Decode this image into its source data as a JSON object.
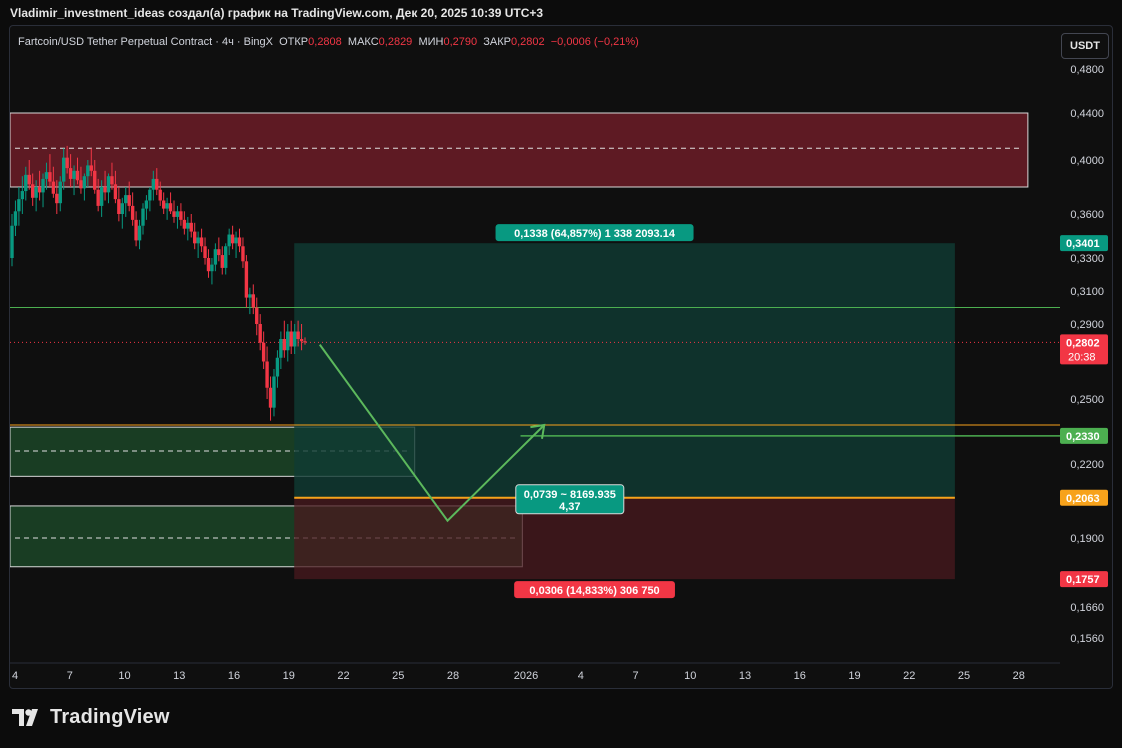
{
  "header": {
    "attribution": "Vladimir_investment_ideas создал(а) график на TradingView.com, Дек 20, 2025 10:39 UTC+3"
  },
  "legend": {
    "symbol": "Fartcoin/USD Tether Perpetual Contract · 4ч · BingX",
    "open_label": "ОТКР",
    "open": "0,2808",
    "high_label": "МАКС",
    "high": "0,2829",
    "low_label": "МИН",
    "low": "0,2790",
    "close_label": "ЗАКР",
    "close": "0,2802",
    "change": "−0,0006 (−0,21%)"
  },
  "currency_button": "USDT",
  "footer": {
    "brand": "TradingView"
  },
  "colors": {
    "up": "#089981",
    "down": "#f23645",
    "green_line": "#4caf50",
    "orange_line": "#f7a21b",
    "supply_zone": "#7a1f2b",
    "demand_zone": "#1e4d2b",
    "target_zone": "#0f3b33",
    "stop_zone": "#4a1a1f",
    "badge_teal": "#089981",
    "badge_red": "#f23645"
  },
  "chart_data": {
    "type": "candlestick",
    "yaxis_ticks": [
      "0,4800",
      "0,4400",
      "0,4000",
      "0,3600",
      "0,3300",
      "0,3100",
      "0,2900",
      "0,2500",
      "0,2200",
      "0,1900",
      "0,1660",
      "0,1560"
    ],
    "ytick_values": [
      0.48,
      0.44,
      0.4,
      0.36,
      0.33,
      0.31,
      0.29,
      0.25,
      0.22,
      0.19,
      0.166,
      0.156
    ],
    "xaxis_ticks": [
      "4",
      "7",
      "10",
      "13",
      "16",
      "19",
      "22",
      "25",
      "28",
      "2026",
      "4",
      "7",
      "10",
      "13",
      "16",
      "19",
      "22",
      "25",
      "28"
    ],
    "current_price": {
      "value": 0.2802,
      "label": "0,2802",
      "countdown": "20:38"
    },
    "price_badges": [
      {
        "value": 0.3401,
        "label": "0,3401",
        "color": "#089981"
      },
      {
        "value": 0.233,
        "label": "0,2330",
        "color": "#4caf50"
      },
      {
        "value": 0.2063,
        "label": "0,2063",
        "color": "#f7a21b"
      },
      {
        "value": 0.1757,
        "label": "0,1757",
        "color": "#f23645"
      }
    ],
    "horizontal_lines": [
      {
        "value": 0.3,
        "color": "#4caf50"
      },
      {
        "value": 0.238,
        "color": "#f7a21b"
      }
    ],
    "zones": [
      {
        "name": "supply",
        "top": 0.44,
        "bottom": 0.38,
        "mid": 0.41,
        "x0": 0,
        "x1": 55.5,
        "color": "#7a1f2b"
      },
      {
        "name": "demand-1",
        "top": 0.237,
        "bottom": 0.215,
        "mid": 0.226,
        "x0": 0,
        "x1": 21.9,
        "color": "#1e4d2b"
      },
      {
        "name": "demand-2",
        "top": 0.203,
        "bottom": 0.18,
        "mid": 0.19,
        "x0": 0,
        "x1": 27.8,
        "color": "#1e4d2b"
      }
    ],
    "position": {
      "x0": 15.3,
      "x1": 51.5,
      "entry": 0.2063,
      "target": 0.3401,
      "stop": 0.1757,
      "target_label": "0,1338 (64,857%) 1 338 2093.14",
      "center_label_1": "0,0739 ~ 8169.935",
      "center_label_2": "4,37",
      "stop_label": "0,0306 (14,833%) 306 750"
    },
    "projection_path": [
      {
        "day": 16.7,
        "price": 0.279
      },
      {
        "day": 23.7,
        "price": 0.197
      },
      {
        "day": 29.0,
        "price": 0.238
      }
    ],
    "target_level": {
      "day_start": 27.7,
      "day_end": 51.5,
      "value": 0.233
    },
    "xaxis_days": [
      0,
      3,
      6,
      9,
      12,
      15,
      18,
      21,
      24,
      28,
      31,
      34,
      37,
      40,
      43,
      46,
      49,
      52,
      55
    ],
    "candles": [
      [
        0.33,
        0.36,
        0.325,
        0.352
      ],
      [
        0.352,
        0.37,
        0.345,
        0.362
      ],
      [
        0.362,
        0.38,
        0.352,
        0.371
      ],
      [
        0.371,
        0.388,
        0.36,
        0.377
      ],
      [
        0.377,
        0.395,
        0.37,
        0.389
      ],
      [
        0.389,
        0.4,
        0.378,
        0.382
      ],
      [
        0.382,
        0.39,
        0.366,
        0.372
      ],
      [
        0.372,
        0.385,
        0.362,
        0.38
      ],
      [
        0.38,
        0.392,
        0.37,
        0.376
      ],
      [
        0.376,
        0.39,
        0.365,
        0.386
      ],
      [
        0.386,
        0.398,
        0.378,
        0.391
      ],
      [
        0.391,
        0.405,
        0.38,
        0.384
      ],
      [
        0.384,
        0.395,
        0.372,
        0.375
      ],
      [
        0.375,
        0.385,
        0.36,
        0.368
      ],
      [
        0.368,
        0.388,
        0.362,
        0.384
      ],
      [
        0.384,
        0.41,
        0.378,
        0.402
      ],
      [
        0.402,
        0.412,
        0.39,
        0.394
      ],
      [
        0.394,
        0.405,
        0.38,
        0.386
      ],
      [
        0.386,
        0.396,
        0.374,
        0.392
      ],
      [
        0.392,
        0.402,
        0.382,
        0.385
      ],
      [
        0.385,
        0.395,
        0.375,
        0.379
      ],
      [
        0.379,
        0.39,
        0.37,
        0.388
      ],
      [
        0.388,
        0.4,
        0.38,
        0.396
      ],
      [
        0.396,
        0.41,
        0.388,
        0.392
      ],
      [
        0.392,
        0.4,
        0.375,
        0.378
      ],
      [
        0.378,
        0.386,
        0.362,
        0.366
      ],
      [
        0.366,
        0.385,
        0.358,
        0.38
      ],
      [
        0.38,
        0.392,
        0.37,
        0.376
      ],
      [
        0.376,
        0.39,
        0.368,
        0.388
      ],
      [
        0.388,
        0.398,
        0.378,
        0.382
      ],
      [
        0.382,
        0.392,
        0.368,
        0.371
      ],
      [
        0.371,
        0.38,
        0.355,
        0.36
      ],
      [
        0.36,
        0.372,
        0.35,
        0.368
      ],
      [
        0.368,
        0.38,
        0.358,
        0.374
      ],
      [
        0.374,
        0.384,
        0.362,
        0.366
      ],
      [
        0.366,
        0.376,
        0.352,
        0.356
      ],
      [
        0.356,
        0.362,
        0.338,
        0.342
      ],
      [
        0.342,
        0.356,
        0.336,
        0.352
      ],
      [
        0.352,
        0.368,
        0.346,
        0.364
      ],
      [
        0.364,
        0.374,
        0.356,
        0.37
      ],
      [
        0.37,
        0.38,
        0.362,
        0.378
      ],
      [
        0.378,
        0.392,
        0.37,
        0.386
      ],
      [
        0.386,
        0.394,
        0.374,
        0.378
      ],
      [
        0.378,
        0.384,
        0.366,
        0.37
      ],
      [
        0.37,
        0.376,
        0.36,
        0.364
      ],
      [
        0.364,
        0.372,
        0.356,
        0.368
      ],
      [
        0.368,
        0.376,
        0.36,
        0.362
      ],
      [
        0.362,
        0.37,
        0.354,
        0.358
      ],
      [
        0.358,
        0.366,
        0.35,
        0.362
      ],
      [
        0.362,
        0.368,
        0.352,
        0.356
      ],
      [
        0.356,
        0.362,
        0.346,
        0.35
      ],
      [
        0.35,
        0.358,
        0.342,
        0.354
      ],
      [
        0.354,
        0.36,
        0.344,
        0.348
      ],
      [
        0.348,
        0.354,
        0.336,
        0.34
      ],
      [
        0.34,
        0.348,
        0.33,
        0.344
      ],
      [
        0.344,
        0.35,
        0.334,
        0.338
      ],
      [
        0.338,
        0.344,
        0.326,
        0.33
      ],
      [
        0.33,
        0.336,
        0.318,
        0.322
      ],
      [
        0.322,
        0.33,
        0.314,
        0.326
      ],
      [
        0.326,
        0.34,
        0.322,
        0.336
      ],
      [
        0.336,
        0.344,
        0.328,
        0.332
      ],
      [
        0.332,
        0.338,
        0.32,
        0.324
      ],
      [
        0.324,
        0.34,
        0.32,
        0.338
      ],
      [
        0.338,
        0.35,
        0.332,
        0.346
      ],
      [
        0.346,
        0.352,
        0.336,
        0.34
      ],
      [
        0.34,
        0.348,
        0.33,
        0.344
      ],
      [
        0.344,
        0.35,
        0.334,
        0.338
      ],
      [
        0.338,
        0.344,
        0.324,
        0.328
      ],
      [
        0.328,
        0.332,
        0.3,
        0.306
      ],
      [
        0.306,
        0.312,
        0.296,
        0.308
      ],
      [
        0.308,
        0.314,
        0.296,
        0.3
      ],
      [
        0.3,
        0.306,
        0.284,
        0.29
      ],
      [
        0.29,
        0.296,
        0.276,
        0.28
      ],
      [
        0.28,
        0.286,
        0.266,
        0.27
      ],
      [
        0.27,
        0.278,
        0.25,
        0.256
      ],
      [
        0.256,
        0.262,
        0.24,
        0.246
      ],
      [
        0.246,
        0.266,
        0.242,
        0.262
      ],
      [
        0.262,
        0.276,
        0.256,
        0.272
      ],
      [
        0.272,
        0.286,
        0.266,
        0.282
      ],
      [
        0.282,
        0.292,
        0.272,
        0.276
      ],
      [
        0.276,
        0.29,
        0.27,
        0.286
      ],
      [
        0.286,
        0.292,
        0.274,
        0.278
      ],
      [
        0.278,
        0.29,
        0.274,
        0.286
      ],
      [
        0.286,
        0.292,
        0.278,
        0.282
      ],
      [
        0.282,
        0.29,
        0.276,
        0.2808
      ],
      [
        0.2808,
        0.2829,
        0.279,
        0.2802
      ]
    ]
  }
}
